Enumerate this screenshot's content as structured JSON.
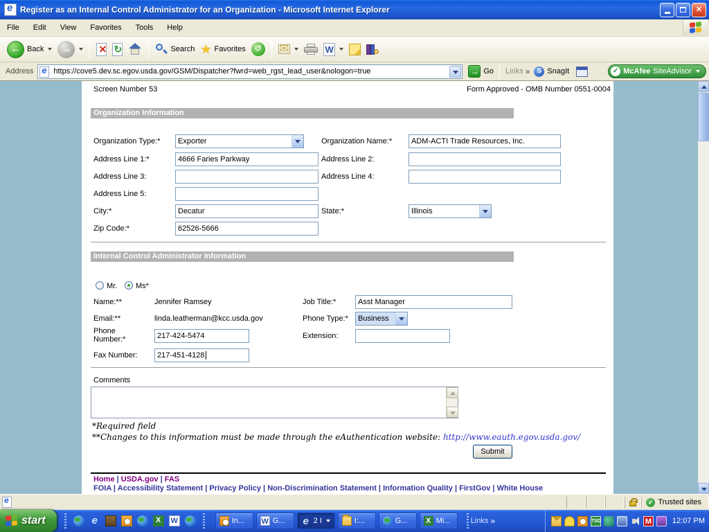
{
  "window": {
    "title": "Register as an Internal Control Administrator for an Organization - Microsoft Internet Explorer"
  },
  "menu": {
    "items": [
      "File",
      "Edit",
      "View",
      "Favorites",
      "Tools",
      "Help"
    ]
  },
  "toolbar": {
    "back": "Back",
    "search": "Search",
    "favorites": "Favorites"
  },
  "address": {
    "label": "Address",
    "url": "https://cove5.dev.sc.egov.usda.gov/GSM/Dispatcher?fwrd=web_rgst_lead_user&nologon=true",
    "go": "Go",
    "links": "Links",
    "snagit": "SnagIt",
    "mcafee_bold": "McAfee",
    "mcafee_rest": "SiteAdvisor"
  },
  "icons": {
    "chevrons": "»",
    "check": "✓",
    "star": "★",
    "stop_x": "✕",
    "refresh": "↻",
    "history": "↺",
    "envelope": "✉",
    "back_arrow": "←",
    "fwd_arrow": "→",
    "go_arrow": "→",
    "s_letter": "S",
    "e_letter": "e",
    "w_letter": "W",
    "x_letter": "X",
    "m_letter": "M",
    "tsd": "TSD"
  },
  "page": {
    "screen_number": "Screen Number 53",
    "form_approved": "Form Approved - OMB Number 0551-0004",
    "org": {
      "header": "Organization Information",
      "type_label": "Organization Type:*",
      "type_value": "Exporter",
      "name_label": "Organization Name:*",
      "name_value": "ADM-ACTI Trade Resources, Inc.",
      "addr1_label": "Address Line 1:*",
      "addr1_value": "4666 Faries Parkway",
      "addr2_label": "Address Line 2:",
      "addr2_value": "",
      "addr3_label": "Address Line 3:",
      "addr3_value": "",
      "addr4_label": "Address Line 4:",
      "addr4_value": "",
      "addr5_label": "Address Line 5:",
      "addr5_value": "",
      "city_label": "City:*",
      "city_value": "Decatur",
      "state_label": "State:*",
      "state_value": "Illinois",
      "zip_label": "Zip Code:*",
      "zip_value": "62526-5666"
    },
    "admin": {
      "header": "Internal Control Administrator Information",
      "salutation_mr": "Mr.",
      "salutation_ms": "Ms*",
      "salutation_selected": "Ms*",
      "name_label": "Name:**",
      "name_value": "Jennifer Ramsey",
      "job_label": "Job Title:*",
      "job_value": "Asst Manager",
      "email_label": "Email:**",
      "email_value": "linda.leatherman@kcc.usda.gov",
      "phone_type_label": "Phone Type:*",
      "phone_type_value": "Business",
      "phone_label": "Phone Number:*",
      "phone_value": "217-424-5474",
      "ext_label": "Extension:",
      "ext_value": "",
      "fax_label": "Fax Number:",
      "fax_value": "217-451-4128"
    },
    "comments_label": "Comments",
    "comments_value": "",
    "required_note": "*Required field",
    "changes_note": "**Changes to this information must be made through the eAuthentication website: ",
    "changes_link": "http://www.eauth.egov.usda.gov/",
    "submit": "Submit",
    "footer": {
      "sep": "|",
      "row1": [
        "Home",
        "USDA.gov",
        "FAS"
      ],
      "row2": [
        "FOIA",
        "Accessibility Statement",
        "Privacy Policy",
        "Non-Discrimination Statement",
        "Information Quality",
        "FirstGov",
        "White House"
      ]
    }
  },
  "status": {
    "trusted": "Trusted sites"
  },
  "taskbar": {
    "start": "start",
    "buttons": [
      {
        "label": "In...",
        "icon": "clock"
      },
      {
        "label": "G...",
        "icon": "word"
      },
      {
        "label": "2 I",
        "icon": "ie",
        "active": true
      },
      {
        "label": "I:...",
        "icon": "folder"
      },
      {
        "label": "G...",
        "icon": "globe"
      },
      {
        "label": "Mi...",
        "icon": "excel"
      }
    ],
    "links": "Links",
    "clock": "12:07 PM"
  },
  "colors": {
    "titlebar_blue": "#1b55cc",
    "page_background": "#96bcca",
    "section_header_gray": "#b2b2b2",
    "input_border": "#7f9db9",
    "footer_link": "#333399",
    "visited_link": "#800080",
    "mcafee_green": "#2f8e3a",
    "go_green": "#1f8e1f"
  }
}
